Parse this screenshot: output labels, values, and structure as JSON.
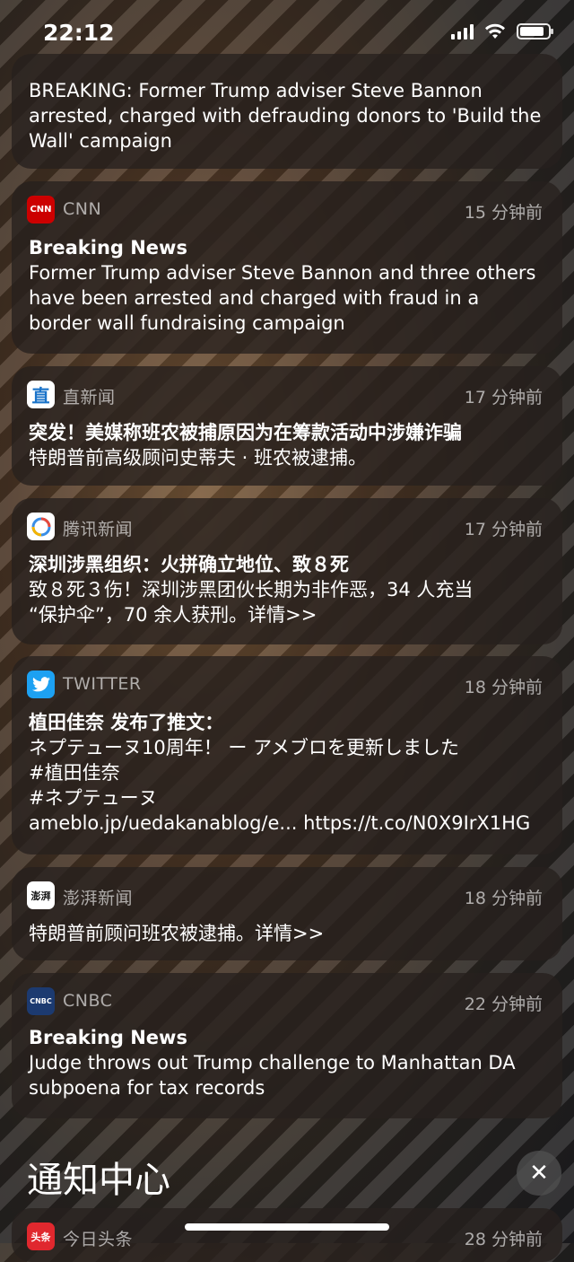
{
  "status_bar": {
    "time": "22:12"
  },
  "notifications": [
    {
      "app": "",
      "time": "",
      "title": "",
      "lines": [
        "BREAKING: Former Trump adviser Steve Bannon",
        "arrested, charged with defrauding donors to 'Build the",
        "Wall' campaign"
      ]
    },
    {
      "app": "CNN",
      "icon_text": "CNN",
      "time": "15 分钟前",
      "title": "Breaking News",
      "lines": [
        "Former Trump adviser Steve Bannon and three others",
        "have been arrested and charged with fraud in a",
        "border wall fundraising campaign"
      ]
    },
    {
      "app": "直新闻",
      "icon_text": "直",
      "time": "17 分钟前",
      "title": "突发！美媒称班农被捕原因为在筹款活动中涉嫌诈骗",
      "lines": [
        "特朗普前高级顾问史蒂夫 · 班农被逮捕。"
      ]
    },
    {
      "app": "腾讯新闻",
      "icon_text": "",
      "time": "17 分钟前",
      "title": "深圳涉黑组织：火拼确立地位、致８死",
      "lines": [
        "致８死３伤！深圳涉黑团伙长期为非作恶，34 人充当",
        "“保护伞”，70 余人获刑。详情>>"
      ]
    },
    {
      "app": "TWITTER",
      "icon_text": "",
      "time": "18 分钟前",
      "title": "植田佳奈 发布了推文：",
      "lines": [
        "ネプテューヌ10周年！ ー アメブロを更新しました",
        "#植田佳奈",
        "#ネプテューヌ",
        "ameblo.jp/uedakanablog/e... https://t.co/N0X9IrX1HG"
      ]
    },
    {
      "app": "澎湃新闻",
      "icon_text": "澎湃",
      "time": "18 分钟前",
      "title": "",
      "lines": [
        "特朗普前顾问班农被逮捕。详情>>"
      ]
    },
    {
      "app": "CNBC",
      "icon_text": "CNBC",
      "time": "22 分钟前",
      "title": "Breaking News",
      "lines": [
        "Judge throws out Trump challenge to Manhattan DA",
        "subpoena for tax records"
      ]
    },
    {
      "app": "今日头条",
      "icon_text": "头条",
      "time": "28 分钟前",
      "title": "",
      "lines": []
    }
  ],
  "notification_center": {
    "title": "通知中心",
    "clear_icon": "✕"
  },
  "colors": {
    "cnn": "#cc0000",
    "zhi": "#ffffff",
    "tencent": "#ffffff",
    "twitter": "#1da1f2",
    "pengpai": "#ffffff",
    "cnbc": "#1c3a70",
    "toutiao": "#e0282e"
  }
}
